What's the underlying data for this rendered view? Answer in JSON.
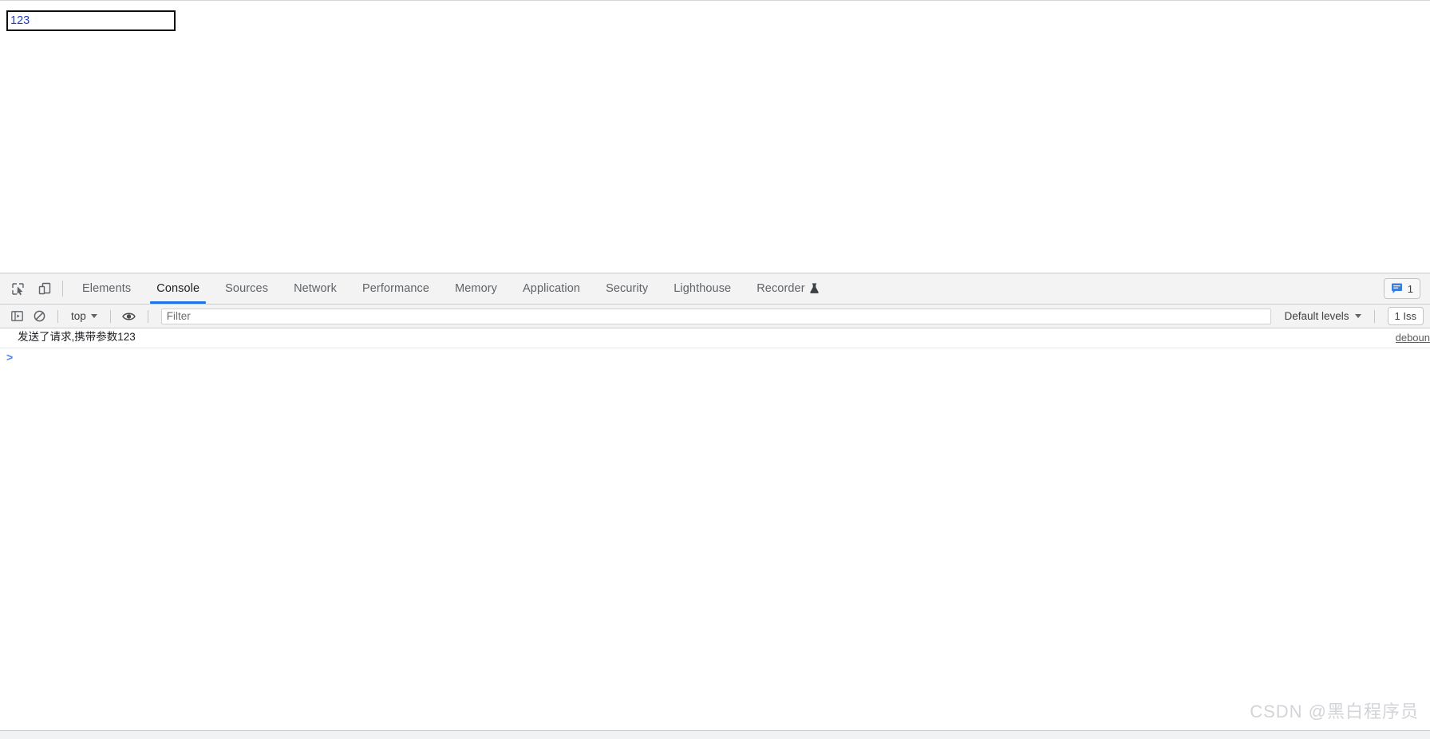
{
  "page": {
    "input": {
      "value": "123",
      "placeholder": ""
    }
  },
  "devtools": {
    "tabbar": {
      "inspect_icon": "inspect-cursor-icon",
      "device_icon": "device-toolbar-icon",
      "tabs": [
        {
          "label": "Elements",
          "active": false
        },
        {
          "label": "Console",
          "active": true
        },
        {
          "label": "Sources",
          "active": false
        },
        {
          "label": "Network",
          "active": false
        },
        {
          "label": "Performance",
          "active": false
        },
        {
          "label": "Memory",
          "active": false
        },
        {
          "label": "Application",
          "active": false
        },
        {
          "label": "Security",
          "active": false
        },
        {
          "label": "Lighthouse",
          "active": false
        },
        {
          "label": "Recorder",
          "active": false,
          "badge_icon": "flask-icon"
        }
      ],
      "messages_chip": {
        "icon": "message-bubble-icon",
        "count": "1"
      }
    },
    "console_toolbar": {
      "sidebar_icon": "console-sidebar-icon",
      "clear_icon": "clear-console-icon",
      "context": "top",
      "eye_icon": "live-expression-eye-icon",
      "filter_placeholder": "Filter",
      "filter_value": "",
      "levels_label": "Default levels",
      "issues_label": "1 Iss"
    },
    "console": {
      "messages": [
        {
          "text": "发送了请求,携带参数123",
          "source": "deboun"
        }
      ],
      "prompt_arrow": ">",
      "prompt_value": ""
    }
  },
  "watermark": "CSDN @黑白程序员",
  "colors": {
    "accent_blue": "#1a73e8",
    "prompt_blue": "#4285f4",
    "toolbar_bg": "#f3f3f3",
    "border": "#cdcdcd",
    "text": "#202124",
    "muted_text": "#5f6368",
    "watermark": "#d2d4d8"
  }
}
